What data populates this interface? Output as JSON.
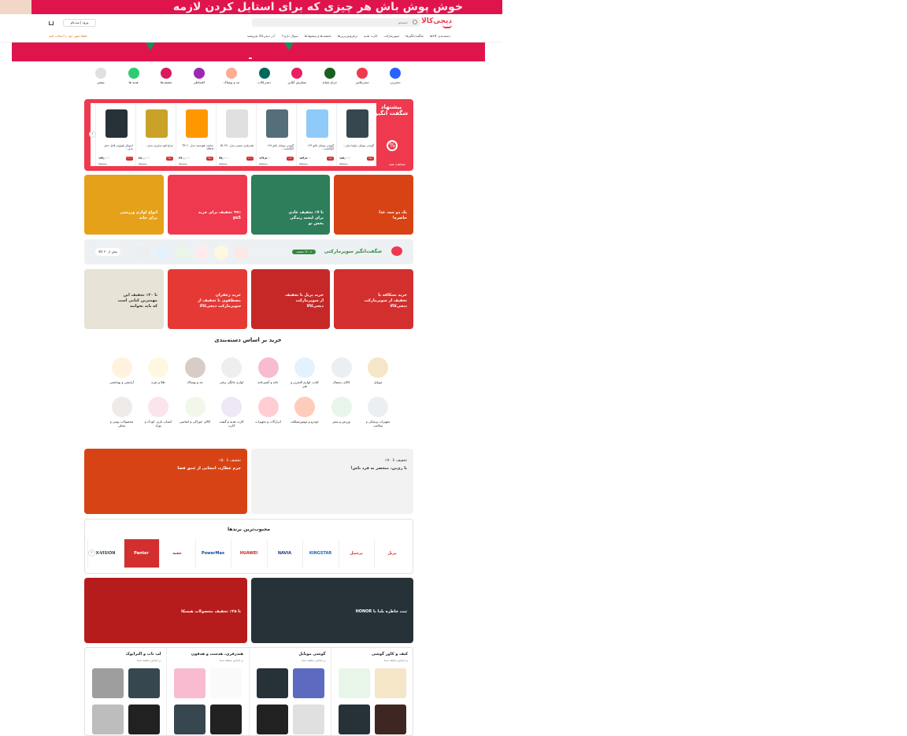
{
  "top_promo": {
    "text": "خوش پوش باش هر چیزی که برای استایل کردن لازمه"
  },
  "header": {
    "logo": "دیجی‌کالا",
    "search_placeholder": "جستجو",
    "login_label": "ورود | ثبت‌نام",
    "location_label": "لطفا شهر خود را انتخاب کنید"
  },
  "nav": [
    "دسته‌بندی کالاها",
    "شگفت‌انگیزها",
    "سوپرمارکت",
    "کارت هدیه",
    "پرفروش‌ترین‌ها",
    "تخفیف‌ها و پیشنهادها",
    "سوال دارید؟",
    "در دیجی‌کالا بفروشید!"
  ],
  "services": [
    {
      "label": "دیجی‌پی",
      "color": "#2962ff"
    },
    {
      "label": "دیجی‌پلاس",
      "color": "#ef394e"
    },
    {
      "label": "حراج شبانه",
      "color": "#1b5e20"
    },
    {
      "label": "سفارش آنلاین",
      "color": "#e91e63"
    },
    {
      "label": "دیجی‌کلاب",
      "color": "#00695c"
    },
    {
      "label": "مد و پوشاک",
      "color": "#ffab91"
    },
    {
      "label": "اقساطی",
      "color": "#9c27b0"
    },
    {
      "label": "تخفیف‌ها",
      "color": "#d81b60"
    },
    {
      "label": "هدیه ها",
      "color": "#2ecc71"
    },
    {
      "label": "بیشتر",
      "color": "#e0e0e0"
    }
  ],
  "amazing": {
    "title": "پیشنهاد شگفت انگیز",
    "view_all": "مشاهده همه",
    "percent": "%",
    "products": [
      {
        "name": "گوشی موبایل ساوتا مدل...",
        "discount": "۳۵٪",
        "price": "۱۸۷,۰۰۰",
        "old": "۲۹۵,۰۰۰",
        "color": "#37474f"
      },
      {
        "name": "گوشی موبایل تکنو ۱۶۴ گیگابایت...",
        "discount": "۱۵٪",
        "price": "۱۸۹,۸۰۰",
        "old": "۲۲۴,۰۰۰",
        "color": "#90caf9"
      },
      {
        "name": "گوشی موبایل تکنو ۱۲۸ گیگابایت...",
        "discount": "۱۲٪",
        "price": "۱۶۹,۸۰۰",
        "old": "۱۹۲,۰۰۰",
        "color": "#546e7a"
      },
      {
        "name": "هندزفری سیمی مدل ۳۷۰ XL",
        "discount": "۲۰٪",
        "price": "۹۹,۰۰۰",
        "old": "۱۲۴,۰۰۰",
        "color": "#e0e0e0"
      },
      {
        "name": "ساعت هوشمند مدل ۲۰ T9 Ultra",
        "discount": "۴۵٪",
        "price": "۳۹۰,۰۰۰",
        "old": "۷۲۰,۰۰۰",
        "color": "#ff9800"
      },
      {
        "name": "چراغ قوه شارژی مدل...",
        "discount": "۲۸٪",
        "price": "۲۸۰,۰۰۰",
        "old": "۳۹۰,۰۰۰",
        "color": "#c9a227"
      },
      {
        "name": "اسپیکر بلوتوثی قابل حمل مدل...",
        "discount": "۳۰٪",
        "price": "۱۷۹,۰۰۰",
        "old": "۲۵۵,۰۰۰",
        "color": "#263238"
      }
    ]
  },
  "banners_row1": [
    {
      "text": "یک دو سه، غذا حاضره!",
      "color": "#d84315"
    },
    {
      "text": "تا ۷٪ تخفیف عادی برای لبخند زندگی بخش تو",
      "color": "#2e7d5b"
    },
    {
      "text": "۹۹٪ تخفیف برای خرید ps5",
      "color": "#ef394e"
    },
    {
      "text": "انواع لوازم ورزشی برای خانه",
      "color": "#e6a11a"
    }
  ],
  "supermarket": {
    "title": "شگفت‌انگیز سوپرمارکتی",
    "badge": "تا ۳۰٪ تخفیف",
    "more": "بیش از ۴۰ کالا"
  },
  "banners_row2": [
    {
      "text": "خرید نسکافه با تخفیف از سوپرمارکت دیجی‌کالا",
      "color": "#d32f2f"
    },
    {
      "text": "خرید پریل با تخفیف از سوپرمارکت دیجی‌کالا",
      "color": "#c62828"
    },
    {
      "text": "خرید زعفران مصطفوی با تخفیف از سوپرمارکت دیجی‌کالا",
      "color": "#e53935"
    },
    {
      "text": "تا ۳۰٪ تخفیف این مهمترین کتابی است که باید بخوانید",
      "color": "#e8e3d7"
    }
  ],
  "categories_title": "خرید بر اساس دسته‌بندی",
  "categories": [
    "موبایل",
    "کالای دیجیتال",
    "کتاب، لوازم التحریر و هنر",
    "خانه و آشپزخانه",
    "لوازم خانگی برقی",
    "مد و پوشاک",
    "طلا و نقره",
    "آرایشی و بهداشتی",
    "تجهیزات پزشکی و سلامت",
    "ورزش و سفر",
    "خودرو و موتورسیکلت",
    "ابزارآلات و تجهیزات",
    "کارت هدیه و گیفت کارت",
    "کالای خوراکی و اساسی",
    "اسباب بازی، کودک و نوزاد",
    "محصولات بومی و محلی"
  ],
  "banners_row3": [
    {
      "text": "با ری‌بن، منحصر به فرد باش!",
      "sub": "تخفیف تا ۷۰٪",
      "color": "#f2f2f2"
    },
    {
      "text": "چرم عطارد، انتخابی از عمق فضا",
      "sub": "تخفیف تا ۵۰٪",
      "color": "#d84315"
    }
  ],
  "brands": {
    "title": "محبوب‌ترین برندها",
    "items": [
      "پریل",
      "پرسیل",
      "KINGSTAR",
      "NAVIA",
      "HUAWEI",
      "PowerMax",
      "جعبه",
      "Panter",
      "X-VISION"
    ]
  },
  "banners_row4": [
    {
      "text": "ثبت خاطره بلدا با HONOR",
      "color": "#263238"
    },
    {
      "text": "تا ۲۵٪ تخفیف محصولات هیسکا",
      "color": "#b71c1c"
    }
  ],
  "bottom_columns": [
    {
      "title": "کیف و کاور گوشی",
      "sub": "بر اساس سلیقه شما",
      "colors": [
        "#f5e6c8",
        "#e8f5e9",
        "#3e2723",
        "#263238"
      ]
    },
    {
      "title": "گوشی موبایل",
      "sub": "بر اساس سلیقه شما",
      "colors": [
        "#5c6bc0",
        "#263238",
        "#e0e0e0",
        "#212121"
      ]
    },
    {
      "title": "هندزفری، هدست و هدفون",
      "sub": "بر اساس سلیقه شما",
      "colors": [
        "#fafafa",
        "#f8bbd0",
        "#212121",
        "#37474f"
      ]
    },
    {
      "title": "لپ تاپ و الترابوک",
      "sub": "بر اساس سلیقه شما",
      "colors": [
        "#37474f",
        "#9e9e9e",
        "#212121",
        "#bdbdbd"
      ]
    }
  ]
}
